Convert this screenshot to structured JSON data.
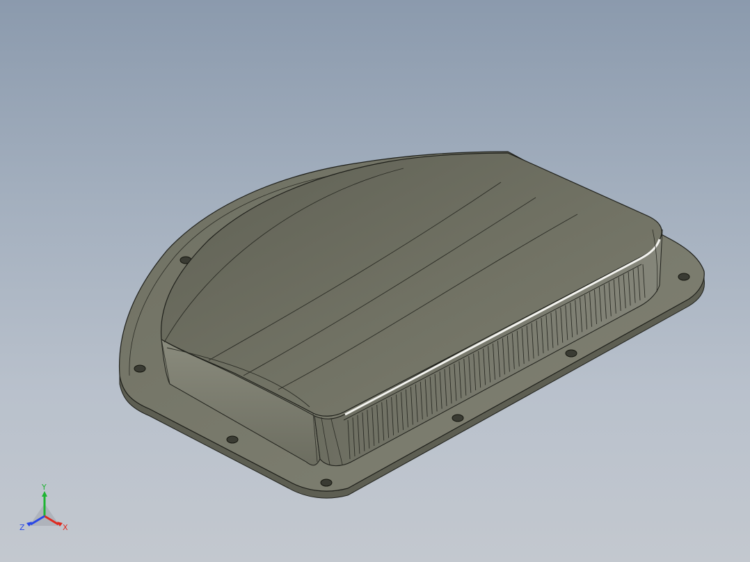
{
  "viewport": {
    "view": "isometric",
    "display_mode": "shaded-with-edges",
    "background_colors": [
      "#8b9aad",
      "#c3c8cf"
    ]
  },
  "model": {
    "body_color": "#6e6f60",
    "flange_color": "#77786a",
    "edge_color": "#1e1f1a",
    "highlight_color": "#f4f4f0",
    "mounting_hole_count": 10
  },
  "triad": {
    "x_label": "X",
    "y_label": "Y",
    "z_label": "Z",
    "x_color": "#e0281e",
    "y_color": "#1eb432",
    "z_color": "#2846e6"
  }
}
